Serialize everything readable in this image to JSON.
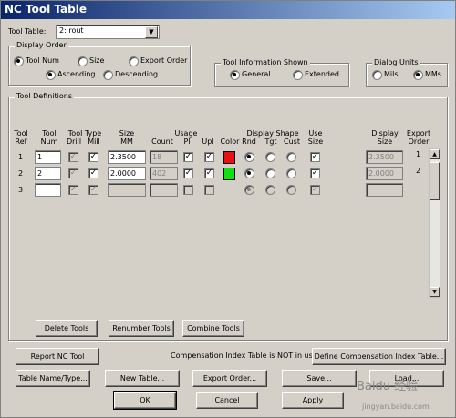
{
  "window": {
    "title": "NC Tool Table"
  },
  "tool_table": {
    "label": "Tool Table:",
    "selected": "2: rout"
  },
  "display_order": {
    "legend": "Display Order",
    "tool_num": "Tool Num",
    "size": "Size",
    "export_order": "Export Order",
    "ascending": "Ascending",
    "descending": "Descending"
  },
  "tool_info": {
    "legend": "Tool Information Shown",
    "general": "General",
    "extended": "Extended"
  },
  "dialog_units": {
    "legend": "Dialog Units",
    "mils": "Mils",
    "mms": "MMs"
  },
  "tool_defs": {
    "legend": "Tool Definitions",
    "headers": {
      "tool_ref": [
        "Tool",
        "Ref"
      ],
      "tool_num": [
        "Tool",
        "Num"
      ],
      "tool_type": "Tool Type",
      "drill": "Drill",
      "mill": "Mill",
      "size": [
        "Size",
        "MM"
      ],
      "count": "Count",
      "usage": "Usage",
      "pl": "Pl",
      "upl": "Upl",
      "color": "Color",
      "display_shape": "Display Shape",
      "rnd": "Rnd",
      "tgt": "Tgt",
      "cust": "Cust",
      "use_size": [
        "Use",
        "Size"
      ],
      "display_size": [
        "Display",
        "Size"
      ],
      "export_order": [
        "Export",
        "Order"
      ]
    },
    "rows": [
      {
        "ref": "1",
        "num": "1",
        "size": "2.3500",
        "count": "18",
        "color": "#e81010",
        "display_size": "2.3500",
        "export_order": "1"
      },
      {
        "ref": "2",
        "num": "2",
        "size": "2.0000",
        "count": "402",
        "color": "#10e010",
        "display_size": "2.0000",
        "export_order": "2"
      },
      {
        "ref": "3",
        "num": "",
        "size": "",
        "count": "",
        "color": "",
        "display_size": "",
        "export_order": ""
      }
    ],
    "delete_tools": "Delete Tools",
    "renumber_tools": "Renumber Tools",
    "combine_tools": "Combine Tools"
  },
  "actions": {
    "report_nc_tool": "Report NC Tool",
    "comp_status": "Compensation Index Table is NOT in use:",
    "define_comp": "Define Compensation Index Table...",
    "table_name_type": "Table Name/Type...",
    "new_table": "New Table...",
    "export_order": "Export Order...",
    "save": "Save...",
    "load": "Load...",
    "ok": "OK",
    "cancel": "Cancel",
    "apply": "Apply"
  },
  "watermark": {
    "brand": "Baidu 经验",
    "url": "jingyan.baidu.com"
  }
}
